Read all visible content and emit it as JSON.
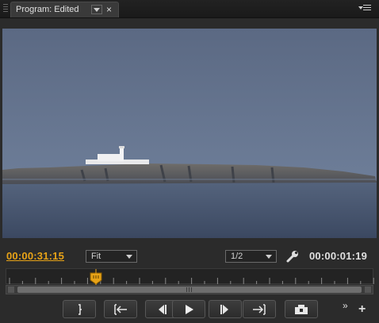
{
  "panel": {
    "tab_title": "Program: Edited",
    "close_glyph": "×"
  },
  "viewer": {
    "scene": "seascape with a white lighthouse on a rocky island under a grey-blue sky"
  },
  "controls": {
    "current_timecode": "00:00:31:15",
    "zoom_level": "Fit",
    "playback_resolution": "1/2",
    "duration_timecode": "00:00:01:19",
    "current_timecode_color": "#e8a317"
  },
  "timeline": {
    "playhead_position_fraction": 0.245
  },
  "transport": {
    "buttons": [
      {
        "name": "mark-out",
        "icon": "mark-out-icon"
      },
      {
        "name": "go-to-in",
        "icon": "go-to-in-icon"
      },
      {
        "name": "step-back",
        "icon": "step-back-icon"
      },
      {
        "name": "play",
        "icon": "play-icon"
      },
      {
        "name": "step-forward",
        "icon": "step-forward-icon"
      },
      {
        "name": "go-to-out",
        "icon": "go-to-out-icon"
      },
      {
        "name": "export-frame",
        "icon": "camera-icon"
      }
    ],
    "overflow_glyph": "»",
    "add_glyph": "+"
  }
}
